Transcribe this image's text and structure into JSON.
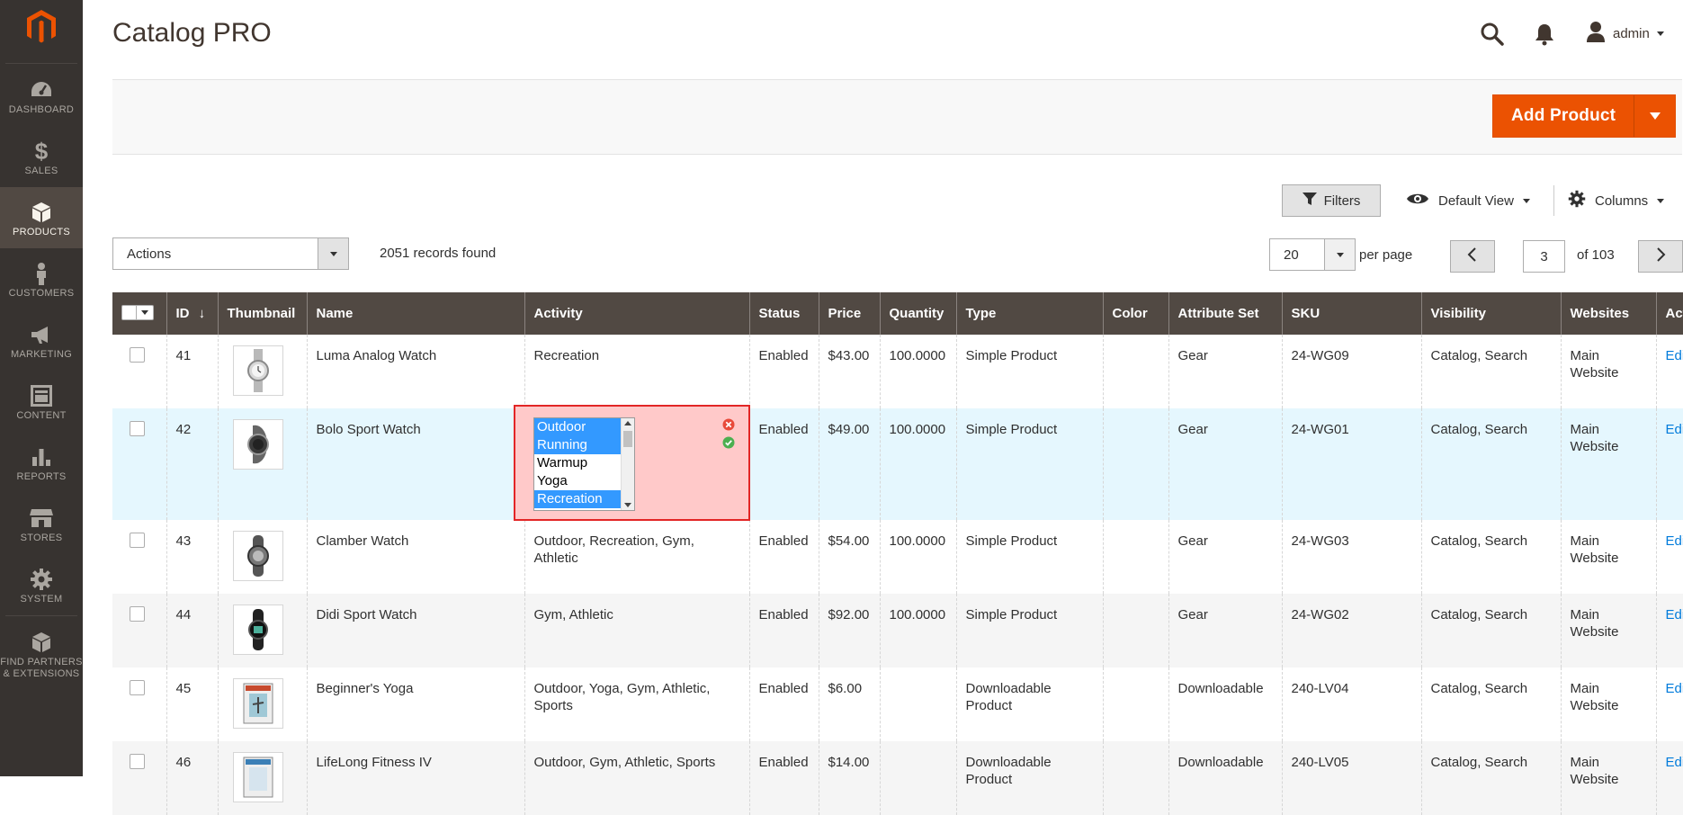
{
  "sidebar": {
    "items": [
      {
        "label": "DASHBOARD",
        "icon": "dashboard-icon"
      },
      {
        "label": "SALES",
        "icon": "dollar-icon"
      },
      {
        "label": "PRODUCTS",
        "icon": "cube-icon",
        "active": true
      },
      {
        "label": "CUSTOMERS",
        "icon": "person-icon"
      },
      {
        "label": "MARKETING",
        "icon": "megaphone-icon"
      },
      {
        "label": "CONTENT",
        "icon": "layout-icon"
      },
      {
        "label": "REPORTS",
        "icon": "bar-chart-icon"
      },
      {
        "label": "STORES",
        "icon": "storefront-icon"
      },
      {
        "label": "SYSTEM",
        "icon": "gear-icon"
      }
    ],
    "partners_line1": "FIND PARTNERS",
    "partners_line2": "& EXTENSIONS"
  },
  "header": {
    "title": "Catalog PRO",
    "user": "admin"
  },
  "action_bar": {
    "add_product": "Add Product"
  },
  "toolbar": {
    "filters": "Filters",
    "view": "Default View",
    "columns": "Columns",
    "actions": "Actions",
    "records": "2051 records found",
    "per_page_value": "20",
    "per_page_label": "per page",
    "page": "3",
    "of_pages": "of 103"
  },
  "grid": {
    "columns": [
      "ID",
      "Thumbnail",
      "Name",
      "Activity",
      "Status",
      "Price",
      "Quantity",
      "Type",
      "Color",
      "Attribute Set",
      "SKU",
      "Visibility",
      "Websites",
      "Action"
    ],
    "rows": [
      {
        "id": "41",
        "name": "Luma Analog Watch",
        "activity": "Recreation",
        "status": "Enabled",
        "price": "$43.00",
        "qty": "100.0000",
        "type": "Simple Product",
        "color": "",
        "attr_set": "Gear",
        "sku": "24-WG09",
        "visibility": "Catalog, Search",
        "websites": "Main Website",
        "action": "Edit"
      },
      {
        "id": "42",
        "name": "Bolo Sport Watch",
        "activity": "",
        "status": "Enabled",
        "price": "$49.00",
        "qty": "100.0000",
        "type": "Simple Product",
        "color": "",
        "attr_set": "Gear",
        "sku": "24-WG01",
        "visibility": "Catalog, Search",
        "websites": "Main Website",
        "action": "Edit"
      },
      {
        "id": "43",
        "name": "Clamber Watch",
        "activity": "Outdoor, Recreation, Gym, Athletic",
        "status": "Enabled",
        "price": "$54.00",
        "qty": "100.0000",
        "type": "Simple Product",
        "color": "",
        "attr_set": "Gear",
        "sku": "24-WG03",
        "visibility": "Catalog, Search",
        "websites": "Main Website",
        "action": "Edit"
      },
      {
        "id": "44",
        "name": "Didi Sport Watch",
        "activity": "Gym, Athletic",
        "status": "Enabled",
        "price": "$92.00",
        "qty": "100.0000",
        "type": "Simple Product",
        "color": "",
        "attr_set": "Gear",
        "sku": "24-WG02",
        "visibility": "Catalog, Search",
        "websites": "Main Website",
        "action": "Edit"
      },
      {
        "id": "45",
        "name": "Beginner's Yoga",
        "activity": "Outdoor, Yoga, Gym, Athletic, Sports",
        "status": "Enabled",
        "price": "$6.00",
        "qty": "",
        "type": "Downloadable Product",
        "color": "",
        "attr_set": "Downloadable",
        "sku": "240-LV04",
        "visibility": "Catalog, Search",
        "websites": "Main Website",
        "action": "Edit"
      },
      {
        "id": "46",
        "name": "LifeLong Fitness IV",
        "activity": "Outdoor, Gym, Athletic, Sports",
        "status": "Enabled",
        "price": "$14.00",
        "qty": "",
        "type": "Downloadable Product",
        "color": "",
        "attr_set": "Downloadable",
        "sku": "240-LV05",
        "visibility": "Catalog, Search",
        "websites": "Main Website",
        "action": "Edit"
      }
    ]
  },
  "editor": {
    "options": [
      {
        "label": "Outdoor",
        "selected": true
      },
      {
        "label": "Running",
        "selected": true
      },
      {
        "label": "Warmup",
        "selected": false
      },
      {
        "label": "Yoga",
        "selected": false
      },
      {
        "label": "Recreation",
        "selected": true
      }
    ]
  },
  "colors": {
    "sidebar_bg": "#373330",
    "header_bg": "#514943",
    "accent": "#eb5202",
    "link": "#007bdb",
    "editor_bg": "#ffc9c9",
    "editor_border": "#e22626",
    "selection": "#3399ff"
  }
}
